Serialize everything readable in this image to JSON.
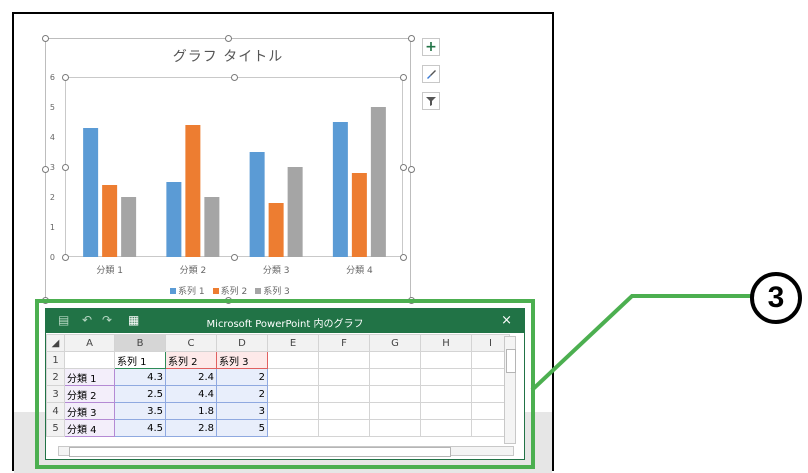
{
  "chart_data": {
    "type": "bar",
    "title": "グラフ タイトル",
    "categories": [
      "分類 1",
      "分類 2",
      "分類 3",
      "分類 4"
    ],
    "series": [
      {
        "name": "系列 1",
        "values": [
          4.3,
          2.5,
          3.5,
          4.5
        ],
        "color": "#5b9bd5"
      },
      {
        "name": "系列 2",
        "values": [
          2.4,
          4.4,
          1.8,
          2.8
        ],
        "color": "#ed7d31"
      },
      {
        "name": "系列 3",
        "values": [
          2,
          2,
          3,
          5
        ],
        "color": "#a5a5a5"
      }
    ],
    "ylim": [
      0,
      6
    ],
    "yticks": [
      "0",
      "1",
      "2",
      "3",
      "4",
      "5",
      "6"
    ],
    "legend": "bottom",
    "grid": false
  },
  "side_buttons": [
    {
      "icon": "plus-icon",
      "glyph": "+"
    },
    {
      "icon": "brush-icon",
      "glyph": "🖌"
    },
    {
      "icon": "filter-icon",
      "glyph": "▼"
    }
  ],
  "excel": {
    "title": "Microsoft PowerPoint 内のグラフ",
    "close": "×",
    "columns": [
      "A",
      "B",
      "C",
      "D",
      "E",
      "F",
      "G",
      "H",
      "I"
    ],
    "rows": [
      {
        "num": "1",
        "cells": [
          "",
          "系列 1",
          "系列 2",
          "系列 3",
          "",
          "",
          "",
          "",
          ""
        ]
      },
      {
        "num": "2",
        "cells": [
          "分類 1",
          "4.3",
          "2.4",
          "2",
          "",
          "",
          "",
          "",
          ""
        ]
      },
      {
        "num": "3",
        "cells": [
          "分類 2",
          "2.5",
          "4.4",
          "2",
          "",
          "",
          "",
          "",
          ""
        ]
      },
      {
        "num": "4",
        "cells": [
          "分類 3",
          "3.5",
          "1.8",
          "3",
          "",
          "",
          "",
          "",
          ""
        ]
      },
      {
        "num": "5",
        "cells": [
          "分類 4",
          "4.5",
          "2.8",
          "5",
          "",
          "",
          "",
          "",
          ""
        ]
      }
    ]
  },
  "callout": {
    "number": "3",
    "color": "#4caf50"
  }
}
